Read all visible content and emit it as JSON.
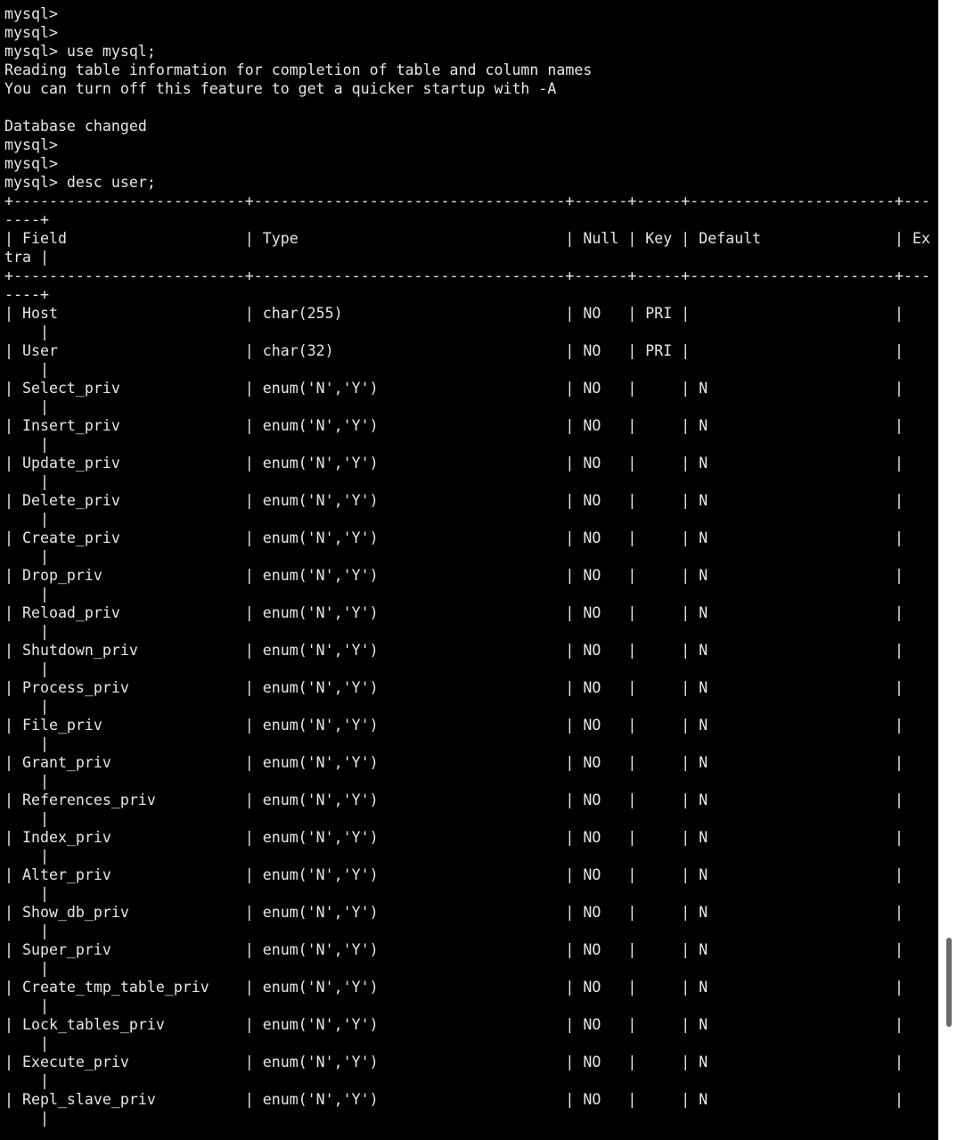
{
  "terminal": {
    "lines": [
      "mysql>",
      "mysql>",
      "mysql> use mysql;",
      "Reading table information for completion of table and column names",
      "You can turn off this feature to get a quicker startup with -A",
      "",
      "Database changed",
      "mysql>",
      "mysql>",
      "mysql> desc user;",
      "+--------------------------+-----------------------------------+------+-----+-----------------------+---",
      "----+",
      "| Field                    | Type                              | Null | Key | Default               | Ex",
      "tra |",
      "+--------------------------+-----------------------------------+------+-----+-----------------------+---",
      "----+",
      "| Host                     | char(255)                         | NO   | PRI |                       |",
      "    |",
      "| User                     | char(32)                          | NO   | PRI |                       |",
      "    |",
      "| Select_priv              | enum('N','Y')                     | NO   |     | N                     |",
      "    |",
      "| Insert_priv              | enum('N','Y')                     | NO   |     | N                     |",
      "    |",
      "| Update_priv              | enum('N','Y')                     | NO   |     | N                     |",
      "    |",
      "| Delete_priv              | enum('N','Y')                     | NO   |     | N                     |",
      "    |",
      "| Create_priv              | enum('N','Y')                     | NO   |     | N                     |",
      "    |",
      "| Drop_priv                | enum('N','Y')                     | NO   |     | N                     |",
      "    |",
      "| Reload_priv              | enum('N','Y')                     | NO   |     | N                     |",
      "    |",
      "| Shutdown_priv            | enum('N','Y')                     | NO   |     | N                     |",
      "    |",
      "| Process_priv             | enum('N','Y')                     | NO   |     | N                     |",
      "    |",
      "| File_priv                | enum('N','Y')                     | NO   |     | N                     |",
      "    |",
      "| Grant_priv               | enum('N','Y')                     | NO   |     | N                     |",
      "    |",
      "| References_priv          | enum('N','Y')                     | NO   |     | N                     |",
      "    |",
      "| Index_priv               | enum('N','Y')                     | NO   |     | N                     |",
      "    |",
      "| Alter_priv               | enum('N','Y')                     | NO   |     | N                     |",
      "    |",
      "| Show_db_priv             | enum('N','Y')                     | NO   |     | N                     |",
      "    |",
      "| Super_priv               | enum('N','Y')                     | NO   |     | N                     |",
      "    |",
      "| Create_tmp_table_priv    | enum('N','Y')                     | NO   |     | N                     |",
      "    |",
      "| Lock_tables_priv         | enum('N','Y')                     | NO   |     | N                     |",
      "    |",
      "| Execute_priv             | enum('N','Y')                     | NO   |     | N                     |",
      "    |",
      "| Repl_slave_priv          | enum('N','Y')                     | NO   |     | N                     |",
      "    |"
    ]
  },
  "colors": {
    "background": "#000000",
    "foreground": "#e6e6e6",
    "scrollbar_track": "#ffffff",
    "scrollbar_thumb": "#6b6b6b"
  }
}
